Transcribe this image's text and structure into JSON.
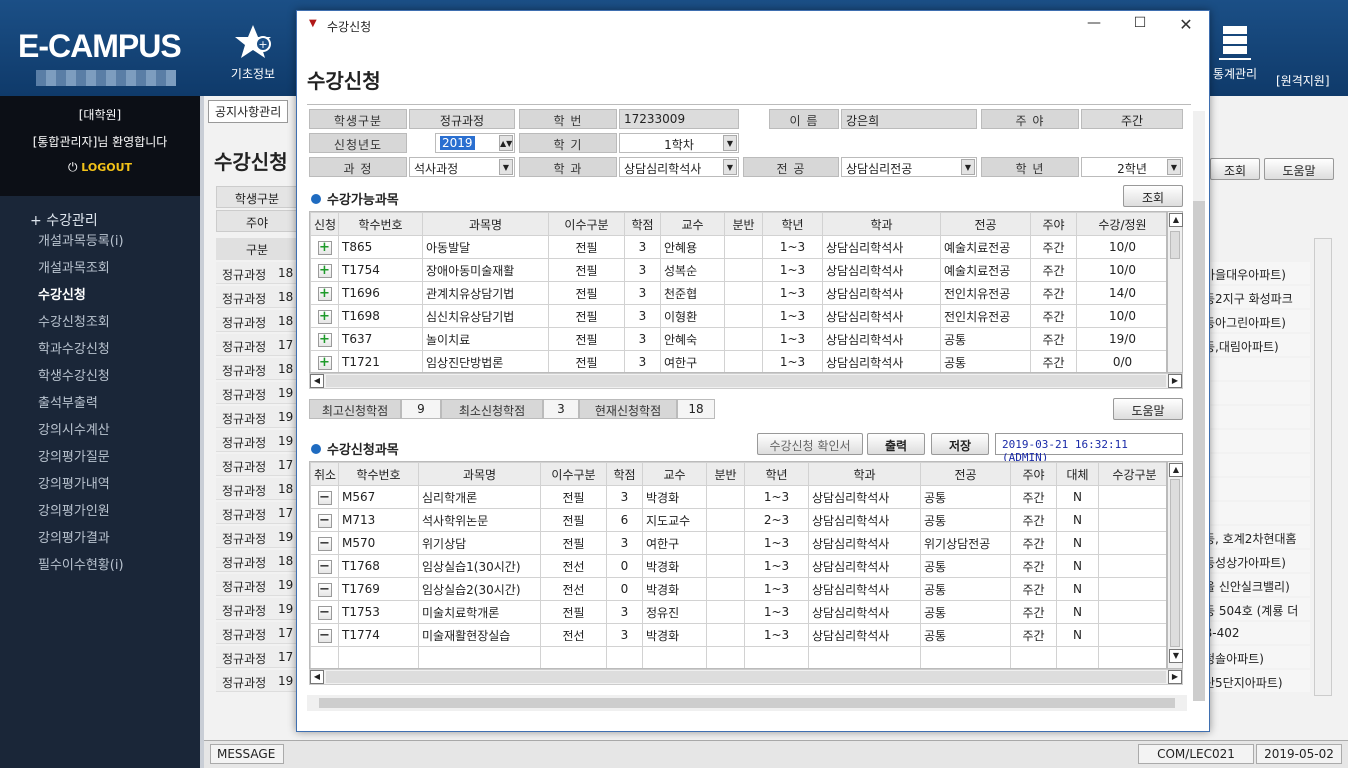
{
  "app": {
    "logo": "E-CAMPUS",
    "nav": [
      "기초정보",
      "통계관리",
      "[원격지원]"
    ]
  },
  "sidebar": {
    "dept": "[대학원]",
    "welcome": "[통합관리자]님 환영합니다",
    "logout": "LOGOUT",
    "section": "수강관리",
    "items": [
      "개설과목등록(i)",
      "개설과목조회",
      "수강신청",
      "수강신청조회",
      "학과수강신청",
      "학생수강신청",
      "출석부출력",
      "강의시수계산",
      "강의평가질문",
      "강의평가내역",
      "강의평가인원",
      "강의평가결과",
      "필수이수현황(i)"
    ]
  },
  "background": {
    "tab": "공지사항관리",
    "title": "수강신청",
    "filter_labels": [
      "학생구분",
      "주야"
    ],
    "col": "구분",
    "buttons": [
      "조회",
      "도움말"
    ],
    "rows": [
      [
        "정규과정",
        "18"
      ],
      [
        "정규과정",
        "18"
      ],
      [
        "정규과정",
        "18"
      ],
      [
        "정규과정",
        "17"
      ],
      [
        "정규과정",
        "18"
      ],
      [
        "정규과정",
        "19"
      ],
      [
        "정규과정",
        "19"
      ],
      [
        "정규과정",
        "19"
      ],
      [
        "정규과정",
        "17"
      ],
      [
        "정규과정",
        "18"
      ],
      [
        "정규과정",
        "17"
      ],
      [
        "정규과정",
        "19"
      ],
      [
        "정규과정",
        "18"
      ],
      [
        "정규과정",
        "19"
      ],
      [
        "정규과정",
        "19"
      ],
      [
        "정규과정",
        "17"
      ],
      [
        "정규과정",
        "17"
      ],
      [
        "정규과정",
        "19"
      ]
    ],
    "right": [
      "마을대우아파트)",
      "동2지구 화성파크",
      "동아그린아파트)",
      "동,대림아파트)",
      ")",
      "",
      "",
      "",
      "",
      "",
      ")",
      "동, 호계2차현대홈",
      "동성상가아파트)",
      "을 신안실크밸리)",
      "동 504호 (계룡 더",
      "B-402",
      "청솔아파트)",
      "산5단지아파트)"
    ]
  },
  "status": {
    "message": "MESSAGE",
    "code": "COM/LEC021",
    "date": "2019-05-02"
  },
  "dialog": {
    "window_title": "수강신청",
    "title": "수강신청",
    "form": {
      "student_type_label": "학생구분",
      "student_type": "정규과정",
      "id_label": "학    번",
      "id": "17233009",
      "name_label": "이    름",
      "name": "강은희",
      "dn_label": "주    야",
      "dn": "주간",
      "year_label": "신청년도",
      "year": "2019",
      "term_label": "학    기",
      "term": "1학차",
      "course_label": "과    정",
      "course": "석사과정",
      "dept_label": "학    과",
      "dept": "상담심리학석사",
      "major_label": "전    공",
      "major": "상담심리전공",
      "grade_label": "학    년",
      "grade": "2학년"
    },
    "avail": {
      "title": "수강가능과목",
      "search": "조회",
      "headers": [
        "신청",
        "학수번호",
        "과목명",
        "이수구분",
        "학점",
        "교수",
        "분반",
        "학년",
        "학과",
        "전공",
        "주야",
        "수강/정원"
      ],
      "rows": [
        [
          "T865",
          "아동발달",
          "전필",
          "3",
          "안혜용",
          "",
          "1~3",
          "상담심리학석사",
          "예술치료전공",
          "주간",
          "10/0"
        ],
        [
          "T1754",
          "장애아동미술재활",
          "전필",
          "3",
          "성복순",
          "",
          "1~3",
          "상담심리학석사",
          "예술치료전공",
          "주간",
          "10/0"
        ],
        [
          "T1696",
          "관계치유상담기법",
          "전필",
          "3",
          "천준협",
          "",
          "1~3",
          "상담심리학석사",
          "전인치유전공",
          "주간",
          "14/0"
        ],
        [
          "T1698",
          "심신치유상담기법",
          "전필",
          "3",
          "이형환",
          "",
          "1~3",
          "상담심리학석사",
          "전인치유전공",
          "주간",
          "10/0"
        ],
        [
          "T637",
          "놀이치료",
          "전필",
          "3",
          "안혜숙",
          "",
          "1~3",
          "상담심리학석사",
          "공통",
          "주간",
          "19/0"
        ],
        [
          "T1721",
          "임상진단방법론",
          "전필",
          "3",
          "여한구",
          "",
          "1~3",
          "상담심리학석사",
          "공통",
          "주간",
          "0/0"
        ]
      ]
    },
    "credits": {
      "max_label": "최고신청학점",
      "max": "9",
      "min_label": "최소신청학점",
      "min": "3",
      "cur_label": "현재신청학점",
      "cur": "18",
      "help": "도움말"
    },
    "reg": {
      "title": "수강신청과목",
      "confirm": "수강신청 확인서",
      "print": "출력",
      "save": "저장",
      "stamp": "2019-03-21 16:32:11 (ADMIN)",
      "headers": [
        "취소",
        "학수번호",
        "과목명",
        "이수구분",
        "학점",
        "교수",
        "분반",
        "학년",
        "학과",
        "전공",
        "주야",
        "대체",
        "수강구분"
      ],
      "rows": [
        [
          "M567",
          "심리학개론",
          "전필",
          "3",
          "박경화",
          "",
          "1~3",
          "상담심리학석사",
          "공통",
          "주간",
          "N",
          ""
        ],
        [
          "M713",
          "석사학위논문",
          "전필",
          "6",
          "지도교수",
          "",
          "2~3",
          "상담심리학석사",
          "공통",
          "주간",
          "N",
          ""
        ],
        [
          "M570",
          "위기상담",
          "전필",
          "3",
          "여한구",
          "",
          "1~3",
          "상담심리학석사",
          "위기상담전공",
          "주간",
          "N",
          ""
        ],
        [
          "T1768",
          "임상실습1(30시간)",
          "전선",
          "0",
          "박경화",
          "",
          "1~3",
          "상담심리학석사",
          "공통",
          "주간",
          "N",
          ""
        ],
        [
          "T1769",
          "임상실습2(30시간)",
          "전선",
          "0",
          "박경화",
          "",
          "1~3",
          "상담심리학석사",
          "공통",
          "주간",
          "N",
          ""
        ],
        [
          "T1753",
          "미술치료학개론",
          "전필",
          "3",
          "정유진",
          "",
          "1~3",
          "상담심리학석사",
          "공통",
          "주간",
          "N",
          ""
        ],
        [
          "T1774",
          "미술재활현장실습",
          "전선",
          "3",
          "박경화",
          "",
          "1~3",
          "상담심리학석사",
          "공통",
          "주간",
          "N",
          ""
        ]
      ]
    }
  },
  "colors": {
    "topbar": "#1b4f86",
    "sidebar": "#1a2638",
    "accent": "#1f6bc0",
    "add": "#1e9a2a"
  }
}
